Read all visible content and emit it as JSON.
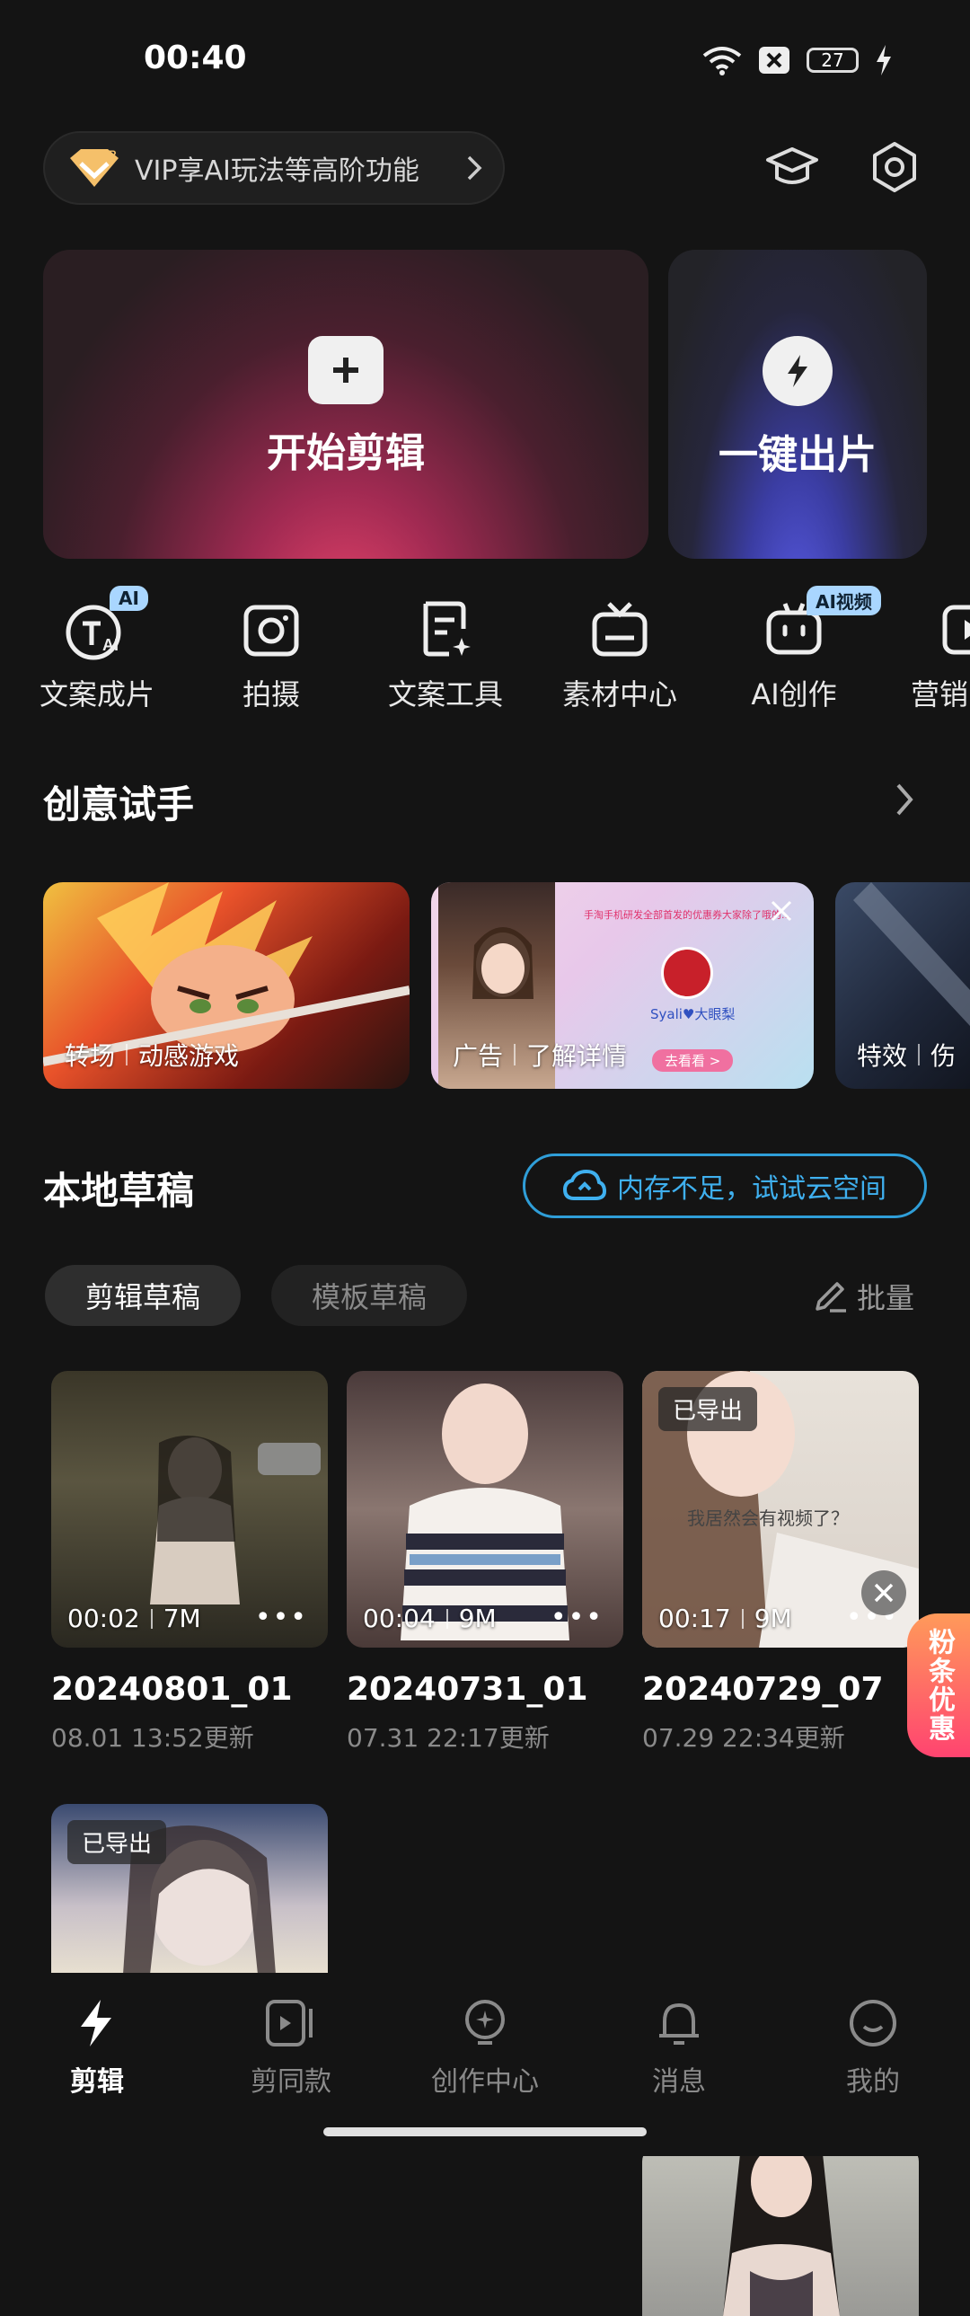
{
  "status_bar": {
    "time": "00:40",
    "battery": "27"
  },
  "header": {
    "vip_text": "VIP享AI玩法等高阶功能"
  },
  "hero": {
    "start_edit": "开始剪辑",
    "one_click": "一键出片"
  },
  "tools": [
    {
      "label": "文案成片",
      "badge": "AI"
    },
    {
      "label": "拍摄"
    },
    {
      "label": "文案工具"
    },
    {
      "label": "素材中心"
    },
    {
      "label": "AI创作",
      "badge": "AI视频"
    },
    {
      "label": "营销"
    }
  ],
  "creative": {
    "title": "创意试手",
    "cards": [
      {
        "tag": "转场",
        "name": "动感游戏"
      },
      {
        "tag": "广告",
        "name": "了解详情",
        "inner_name": "Syali♥大眼梨",
        "inner_cta": "去看看 >",
        "inner_banner": "手淘手机研发全部首发的优惠券大家除了哦的..."
      },
      {
        "tag": "特效",
        "name": "伤"
      }
    ]
  },
  "drafts": {
    "title": "本地草稿",
    "cloud_tip": "内存不足，试试云空间",
    "tab_edit": "剪辑草稿",
    "tab_template": "模板草稿",
    "batch": "批量",
    "exported_label": "已导出",
    "items": [
      {
        "duration": "00:02",
        "size": "7M",
        "name": "20240801_01",
        "updated": "08.01 13:52更新",
        "exported": false
      },
      {
        "duration": "00:04",
        "size": "9M",
        "name": "20240731_01",
        "updated": "07.31 22:17更新",
        "exported": false
      },
      {
        "duration": "00:17",
        "size": "9M",
        "name": "20240729_07",
        "updated": "07.29 22:34更新",
        "exported": true,
        "overlay_text": "我居然会有视频了？"
      }
    ],
    "row2_exported": [
      true,
      true,
      false
    ]
  },
  "promo": {
    "text": "粉条优惠"
  },
  "nav": [
    {
      "label": "剪辑",
      "active": true
    },
    {
      "label": "剪同款"
    },
    {
      "label": "创作中心"
    },
    {
      "label": "消息"
    },
    {
      "label": "我的"
    }
  ]
}
